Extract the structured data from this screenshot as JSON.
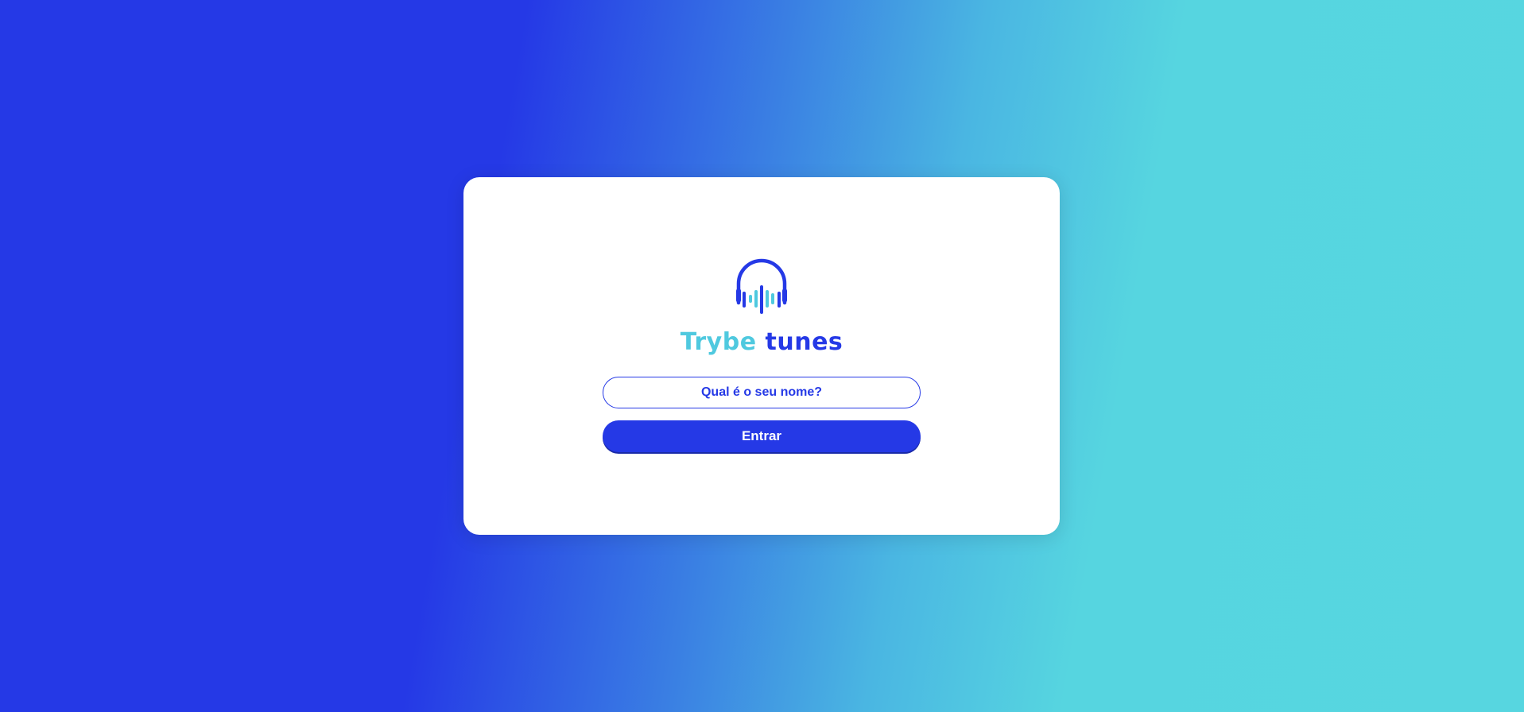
{
  "brand": {
    "first": "Trybe",
    "second": "tunes",
    "icon": "headphones-soundwave-icon"
  },
  "login": {
    "name_placeholder": "Qual é o seu nome?",
    "name_value": "",
    "submit_label": "Entrar"
  },
  "colors": {
    "primary": "#2539e6",
    "accent": "#4fc9df",
    "background_start": "#2539e6",
    "background_end": "#57d6e0",
    "card": "#ffffff"
  }
}
